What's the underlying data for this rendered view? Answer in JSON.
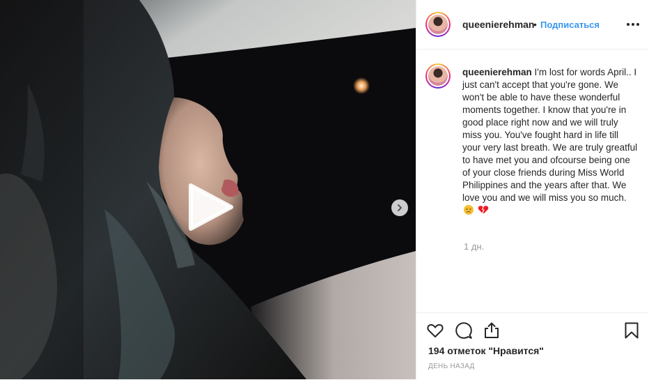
{
  "post": {
    "username": "queenierehman",
    "header_dot": "•",
    "follow_label": "Подписаться",
    "caption_text": "I'm lost for words April.. I just can't accept that you're gone. We won't be able to have these wonderful moments together. I know that you're in good place right now and we will truly miss you. You've fought hard in life till your very last breath. We are truly greatful to have met you and ofcourse being one of your close friends during Miss World Philippines and the years after that. We love you and we will miss you so much.",
    "caption_emojis": [
      "crying-face",
      "broken-heart"
    ],
    "time_ago": "1 дн.",
    "likes": "194 отметок \"Нравится\"",
    "date": "день назад"
  },
  "media": {
    "type": "video",
    "icons": [
      "play-icon",
      "chevron-right-icon"
    ]
  },
  "colors": {
    "link": "#3897f0",
    "text": "#262626",
    "muted": "#999999",
    "heart": "#ed1c24"
  }
}
